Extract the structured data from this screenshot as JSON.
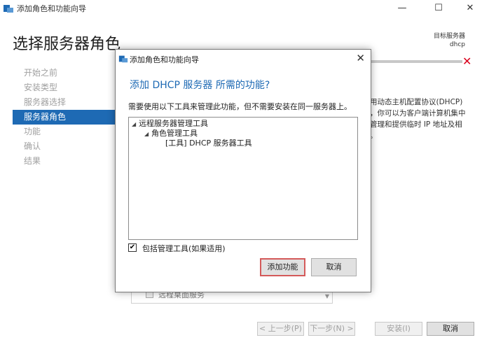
{
  "window": {
    "title": "添加角色和功能向导",
    "min_glyph": "—",
    "max_glyph": "☐",
    "close_glyph": "✕"
  },
  "page": {
    "title": "选择服务器角色",
    "target_label": "目标服务器",
    "target_value": "dhcp"
  },
  "nav": {
    "items": [
      {
        "label": "开始之前"
      },
      {
        "label": "安装类型"
      },
      {
        "label": "服务器选择"
      },
      {
        "label": "服务器角色"
      },
      {
        "label": "功能"
      },
      {
        "label": "确认"
      },
      {
        "label": "结果"
      }
    ],
    "active_index": 3
  },
  "description": {
    "line1": "用动态主机配置协议(DHCP)",
    "line2": "，你可以为客户端计算机集中",
    "line3": "管理和提供临时 IP 地址及相",
    "line4": "。"
  },
  "background_list": {
    "item": "远程桌面服务"
  },
  "footer": {
    "prev": "< 上一步(P)",
    "next": "下一步(N) >",
    "install": "安装(I)",
    "cancel": "取消"
  },
  "dialog": {
    "title": "添加角色和功能向导",
    "close_glyph": "✕",
    "heading": "添加 DHCP 服务器 所需的功能?",
    "note": "需要使用以下工具来管理此功能，但不需要安装在同一服务器上。",
    "tree": [
      {
        "label": "远程服务器管理工具",
        "level": 0,
        "expanded": true
      },
      {
        "label": "角色管理工具",
        "level": 1,
        "expanded": true
      },
      {
        "label": "[工具] DHCP 服务器工具",
        "level": 2
      }
    ],
    "include_tools_label": "包括管理工具(如果适用)",
    "include_tools_checked": true,
    "add_button": "添加功能",
    "cancel_button": "取消"
  },
  "colors": {
    "accent": "#1e6ab4",
    "error": "#d9001b"
  }
}
